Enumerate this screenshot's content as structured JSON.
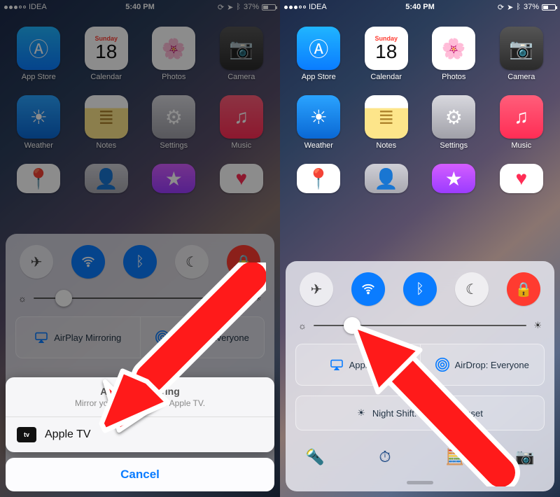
{
  "statusbar": {
    "carrier": "IDEA",
    "time": "5:40 PM",
    "battery_pct": "37%"
  },
  "calendar": {
    "dow": "Sunday",
    "day": "18"
  },
  "apps": {
    "appstore": "App Store",
    "calendar": "Calendar",
    "photos": "Photos",
    "camera": "Camera",
    "weather": "Weather",
    "notes": "Notes",
    "settings": "Settings",
    "music": "Music"
  },
  "cc": {
    "airplay_mirroring": "AirPlay Mirroring",
    "apple_tv": "Apple TV",
    "airdrop": "AirDrop: Everyone",
    "nightshift": "Night Shift: Off Until Sunset",
    "brightness_pct_left": 14,
    "brightness_pct_right": 18
  },
  "sheet": {
    "title": "AirPlay Mirroring",
    "subtitle": "Mirror your iPhone on an Apple TV.",
    "item": "Apple TV",
    "cancel": "Cancel"
  }
}
